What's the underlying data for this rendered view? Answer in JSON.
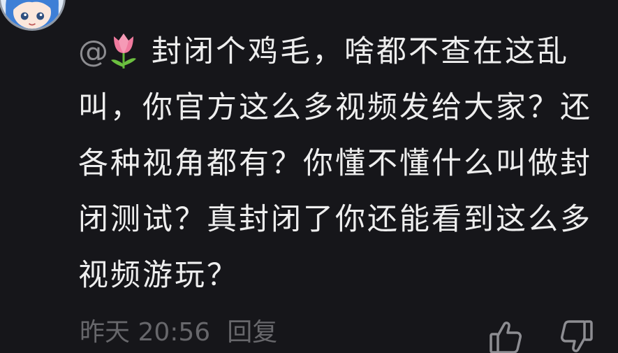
{
  "comment": {
    "mention": "@",
    "text": "封闭个鸡毛，啥都不查在这乱叫，你官方这么多视频发给大家？还各种视角都有？你懂不懂什么叫做封闭测试？真封闭了你还能看到这么多视频游玩？",
    "emoji_icon": "tulip-emoji-icon"
  },
  "footer": {
    "timestamp": "昨天 20:56",
    "reply_label": "回复"
  },
  "actions": {
    "like_icon": "thumbs-up-icon",
    "dislike_icon": "thumbs-down-icon"
  },
  "colors": {
    "background": "#16161a",
    "text": "#eeeeee",
    "muted": "#8c8c90",
    "footer": "#67676b"
  }
}
